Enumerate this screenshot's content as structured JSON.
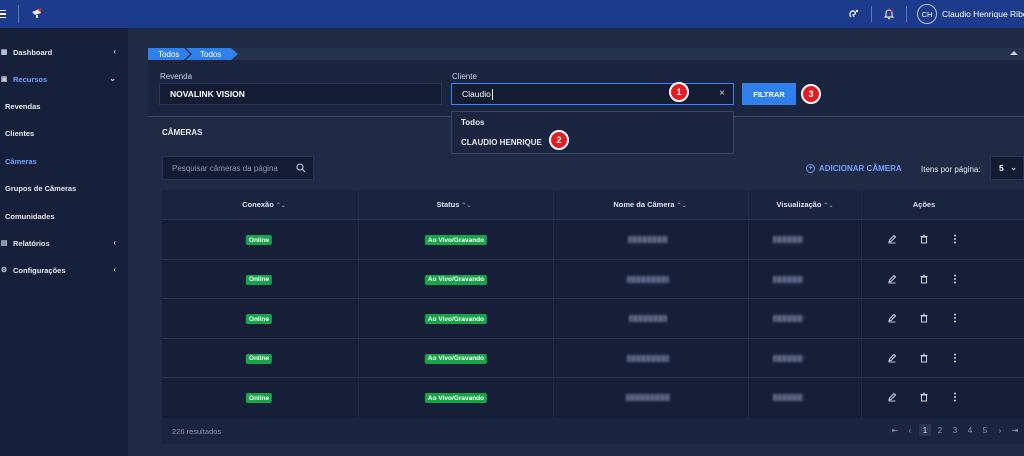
{
  "topbar": {
    "user_initials": "CH",
    "user_name": "Claudio Henrique Ribeiro"
  },
  "sidebar": {
    "items": [
      {
        "label": "Dashboard",
        "icon": "grid-icon",
        "chevron": "‹"
      },
      {
        "label": "Recursos",
        "icon": "box-icon",
        "chevron": "⌄"
      },
      {
        "label": "Revendas"
      },
      {
        "label": "Clientes"
      },
      {
        "label": "Câmeras"
      },
      {
        "label": "Grupos de Câmeras"
      },
      {
        "label": "Comunidades"
      },
      {
        "label": "Relatórios",
        "icon": "report-icon",
        "chevron": "‹"
      },
      {
        "label": "Configurações",
        "icon": "gear-icon",
        "chevron": "‹"
      }
    ]
  },
  "breadcrumb": {
    "items": [
      "Todos",
      "Todos"
    ]
  },
  "filters": {
    "revenda_label": "Revenda",
    "revenda_value": "NOVALINK VISION",
    "cliente_label": "Cliente",
    "cliente_value": "Claudio",
    "filter_button": "FILTRAR",
    "clear_symbol": "×"
  },
  "annotations": {
    "badge1": "1",
    "badge2": "2",
    "badge3": "3"
  },
  "dropdown": {
    "options": [
      "Todos",
      "CLAUDIO HENRIQUE"
    ]
  },
  "cameras": {
    "section_title": "CÂMERAS",
    "search_placeholder": "Pesquisar câmeras da página",
    "add_button": "ADICIONAR CÂMERA",
    "items_per_page_label": "Itens por página:",
    "items_per_page_value": "5",
    "columns": [
      "Conexão",
      "Status",
      "Nome da Câmera",
      "Visualização",
      "Ações"
    ],
    "sort_symbol": "⌃⌄",
    "rows": [
      {
        "connection": "Online",
        "status": "Ao Vivo/Gravando"
      },
      {
        "connection": "Online",
        "status": "Ao Vivo/Gravando"
      },
      {
        "connection": "Online",
        "status": "Ao Vivo/Gravando"
      },
      {
        "connection": "Online",
        "status": "Ao Vivo/Gravando"
      },
      {
        "connection": "Online",
        "status": "Ao Vivo/Gravando"
      }
    ],
    "results_text": "226 resultados",
    "pagination": {
      "first": "⇤",
      "prev": "‹",
      "pages": [
        "1",
        "2",
        "3",
        "4",
        "5"
      ],
      "next": "›",
      "last": "⇥",
      "current": "1"
    }
  },
  "colors": {
    "topbar": "#1d3b8c",
    "accent": "#2f80ed",
    "online_green": "#16a34a",
    "badge_red": "#e31b23"
  }
}
